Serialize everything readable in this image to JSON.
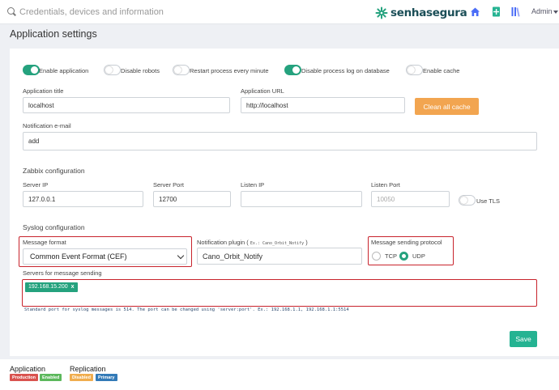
{
  "header": {
    "search_placeholder": "Credentials, devices and information",
    "brand": "senhasegura",
    "user": "Admin",
    "icons": [
      "home-icon",
      "plus-document-icon",
      "library-icon"
    ]
  },
  "page_title": "Application settings",
  "toggles": [
    {
      "label": "Enable application",
      "on": true
    },
    {
      "label": "Disable robots",
      "on": false
    },
    {
      "label": "Restart process every minute",
      "on": false
    },
    {
      "label": "Disable process log on database",
      "on": true
    },
    {
      "label": "Enable cache",
      "on": false
    }
  ],
  "form": {
    "app_title_label": "Application title",
    "app_title_value": "localhost",
    "app_url_label": "Application URL",
    "app_url_value": "http://localhost",
    "clear_cache_label": "Clean all cache",
    "notification_label": "Notification e-mail",
    "notification_value": "add"
  },
  "zabbix": {
    "section": "Zabbix configuration",
    "server_ip_label": "Server IP",
    "server_ip_value": "127.0.0.1",
    "server_port_label": "Server Port",
    "server_port_value": "12700",
    "listen_ip_label": "Listen IP",
    "listen_ip_value": "",
    "listen_port_label": "Listen Port",
    "listen_port_placeholder": "10050",
    "tls_label": "Use TLS",
    "tls_on": false
  },
  "syslog": {
    "section": "Syslog configuration",
    "format_label": "Message format",
    "format_value": "Common Event Format (CEF)",
    "plugin_label": "Notification plugin (",
    "plugin_hint": "Ex.: Cano_Orbit_Notify",
    "plugin_close": ")",
    "plugin_value": "Cano_Orbit_Notify",
    "protocol_label": "Message sending protocol",
    "protocol_options": [
      "TCP",
      "UDP"
    ],
    "protocol_selected": "UDP",
    "servers_label": "Servers for message sending",
    "servers": [
      "192.168.15.200"
    ],
    "tag_remove": "x",
    "hint": "Standard port for syslog messages is 514. The port can be changed using 'server:port'. Ex.: 192.168.1.1, 192.168.1.1:5514"
  },
  "save_label": "Save",
  "footer": {
    "application_title": "Application",
    "application_badges": [
      {
        "label": "Production",
        "color": "#d9534f"
      },
      {
        "label": "Enabled",
        "color": "#5cb85c"
      }
    ],
    "replication_title": "Replication",
    "replication_badges": [
      {
        "label": "Disabled",
        "color": "#f0ad4e"
      },
      {
        "label": "Primary",
        "color": "#337ab7"
      }
    ]
  },
  "colors": {
    "accent": "#25a27e",
    "warning": "#f2a550",
    "highlight_box": "#c8232c",
    "brand": "#1b4e57"
  }
}
